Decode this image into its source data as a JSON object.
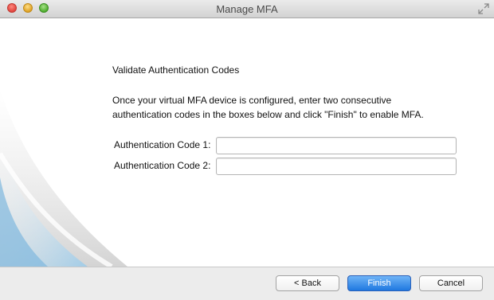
{
  "window": {
    "title": "Manage MFA"
  },
  "content": {
    "heading": "Validate Authentication Codes",
    "instructions": "Once your virtual MFA device is configured, enter two consecutive authentication codes in the boxes below and click \"Finish\" to enable MFA.",
    "code1_label": "Authentication Code 1:",
    "code1_value": "",
    "code2_label": "Authentication Code 2:",
    "code2_value": ""
  },
  "buttons": {
    "back": "< Back",
    "finish": "Finish",
    "cancel": "Cancel"
  },
  "icons": {
    "close": "close-icon",
    "minimize": "minimize-icon",
    "maximize": "maximize-icon",
    "fullscreen": "fullscreen-icon"
  },
  "colors": {
    "accent": "#1f78e0",
    "titlebar": "#d2d2d2",
    "bottombar": "#ececec"
  }
}
